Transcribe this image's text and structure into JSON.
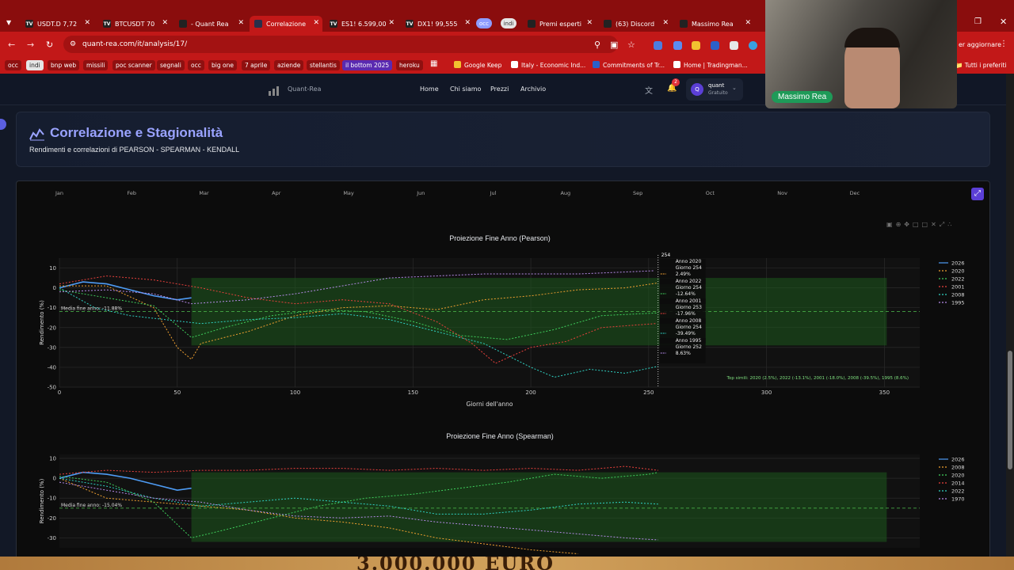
{
  "browser": {
    "tabs": [
      {
        "label": "USDT.D 7,72",
        "icon": "tv-icon"
      },
      {
        "label": "BTCUSDT 70",
        "icon": "tv-icon"
      },
      {
        "label": "- Quant Rea",
        "icon": "quant-icon"
      },
      {
        "label": "Correlazione",
        "icon": "quant-icon"
      },
      {
        "label": "ES1! 6.599,00",
        "icon": "tv-icon"
      },
      {
        "label": "DX1! 99,555",
        "icon": "tv-icon"
      },
      {
        "label": "Premi esperti",
        "icon": "page-icon"
      },
      {
        "label": "(63) Discord",
        "icon": "discord-icon"
      },
      {
        "label": "Massimo Rea",
        "icon": "page-icon"
      }
    ],
    "tab_pills": [
      "occ",
      "indi"
    ],
    "url": "quant-rea.com/it/analysis/17/",
    "update_label": "er aggiornare",
    "bookmarks": [
      "occ",
      "indi",
      "bnp web",
      "missili",
      "poc scanner",
      "segnali",
      "occ",
      "big one",
      "7 aprile",
      "aziende",
      "stellantis",
      "il bottom 2025",
      "heroku"
    ],
    "bookmark_links": [
      "Google Keep",
      "Italy - Economic Ind...",
      "Commitments of Tr...",
      "Home | Tradingman..."
    ],
    "all_bookmarks": "Tutti i preferiti"
  },
  "site": {
    "brand": "Quant-Rea",
    "nav": [
      "Home",
      "Chi siamo",
      "Prezzi",
      "Archivio"
    ],
    "notif_count": "2",
    "user_initial": "Q",
    "user_name": "quant",
    "user_plan": "Gratuito"
  },
  "hero": {
    "title": "Correlazione e Stagionalità",
    "subtitle": "Rendimenti e correlazioni di PEARSON - SPEARMAN - KENDALL"
  },
  "top_axis_months": [
    "Jan",
    "Feb",
    "Mar",
    "Apr",
    "May",
    "Jun",
    "Jul",
    "Aug",
    "Sep",
    "Oct",
    "Nov",
    "Dec"
  ],
  "webcam": {
    "label": "Massimo Rea"
  },
  "poster_text": "3.000.000 EURO",
  "chart_data": [
    {
      "type": "line",
      "title": "Proiezione Fine Anno (Pearson)",
      "xlabel": "Giorni dell'anno",
      "ylabel": "Rendimento (%)",
      "xlim": [
        0,
        365
      ],
      "ylim": [
        -50,
        15
      ],
      "xticks": [
        0,
        50,
        100,
        150,
        200,
        250,
        300,
        350
      ],
      "yticks": [
        10,
        0,
        -10,
        -20,
        -30,
        -40,
        -50
      ],
      "mean_label": "Media fine anno: -11.88%",
      "mean_value": -11.88,
      "band": [
        -29,
        5
      ],
      "band_start": 56,
      "cursor_day": 254,
      "hover_header": "254",
      "hover": [
        {
          "year": "Anno 2020",
          "day": "Giorno 254",
          "value": "2.49%"
        },
        {
          "year": "Anno 2022",
          "day": "Giorno 254",
          "value": "-12.64%"
        },
        {
          "year": "Anno 2001",
          "day": "Giorno 253",
          "value": "-17.96%"
        },
        {
          "year": "Anno 2008",
          "day": "Giorno 254",
          "value": "-39.49%"
        },
        {
          "year": "Anno 1995",
          "day": "Giorno 252",
          "value": "8.63%"
        }
      ],
      "top_similar": "Top simili: 2020 (2.5%), 2022 (-13.1%), 2001 (-18.0%), 2008 (-39.5%), 1995 (8.6%)",
      "series": [
        {
          "name": "2026",
          "color": "#4e9cf5",
          "dash": "",
          "points": [
            [
              0,
              0
            ],
            [
              10,
              3
            ],
            [
              20,
              2
            ],
            [
              30,
              -1
            ],
            [
              40,
              -4
            ],
            [
              50,
              -6
            ],
            [
              56,
              -5
            ]
          ]
        },
        {
          "name": "2020",
          "color": "#f0a030",
          "dash": "2,2",
          "points": [
            [
              0,
              1
            ],
            [
              20,
              1
            ],
            [
              40,
              -10
            ],
            [
              50,
              -30
            ],
            [
              56,
              -36
            ],
            [
              60,
              -28
            ],
            [
              80,
              -22
            ],
            [
              100,
              -14
            ],
            [
              120,
              -10
            ],
            [
              140,
              -9
            ],
            [
              160,
              -11
            ],
            [
              180,
              -6
            ],
            [
              200,
              -4
            ],
            [
              220,
              -1
            ],
            [
              240,
              0
            ],
            [
              254,
              2.5
            ]
          ]
        },
        {
          "name": "2022",
          "color": "#3fcf5c",
          "dash": "2,2",
          "points": [
            [
              0,
              -1
            ],
            [
              20,
              -5
            ],
            [
              40,
              -9
            ],
            [
              56,
              -25
            ],
            [
              70,
              -20
            ],
            [
              90,
              -14
            ],
            [
              110,
              -11
            ],
            [
              130,
              -12
            ],
            [
              150,
              -17
            ],
            [
              170,
              -24
            ],
            [
              190,
              -26
            ],
            [
              210,
              -21
            ],
            [
              230,
              -14
            ],
            [
              254,
              -12.6
            ]
          ]
        },
        {
          "name": "2001",
          "color": "#e8413c",
          "dash": "2,2",
          "points": [
            [
              0,
              2
            ],
            [
              20,
              6
            ],
            [
              40,
              4
            ],
            [
              60,
              0
            ],
            [
              80,
              -5
            ],
            [
              100,
              -8
            ],
            [
              120,
              -6
            ],
            [
              140,
              -8
            ],
            [
              160,
              -17
            ],
            [
              175,
              -28
            ],
            [
              185,
              -38
            ],
            [
              200,
              -30
            ],
            [
              215,
              -27
            ],
            [
              230,
              -20
            ],
            [
              253,
              -18
            ]
          ]
        },
        {
          "name": "2008",
          "color": "#2fd1c2",
          "dash": "2,2",
          "points": [
            [
              0,
              0
            ],
            [
              15,
              -10
            ],
            [
              30,
              -14
            ],
            [
              45,
              -16
            ],
            [
              60,
              -18
            ],
            [
              80,
              -16
            ],
            [
              100,
              -15
            ],
            [
              120,
              -13
            ],
            [
              140,
              -16
            ],
            [
              160,
              -22
            ],
            [
              180,
              -28
            ],
            [
              200,
              -40
            ],
            [
              210,
              -45
            ],
            [
              225,
              -41
            ],
            [
              240,
              -43
            ],
            [
              254,
              -39.5
            ]
          ]
        },
        {
          "name": "1995",
          "color": "#b58ae8",
          "dash": "2,2",
          "points": [
            [
              0,
              -2
            ],
            [
              20,
              -1
            ],
            [
              40,
              -3
            ],
            [
              56,
              -8
            ],
            [
              80,
              -6
            ],
            [
              100,
              -3
            ],
            [
              120,
              1
            ],
            [
              140,
              5
            ],
            [
              160,
              6
            ],
            [
              180,
              7
            ],
            [
              200,
              7
            ],
            [
              220,
              7
            ],
            [
              240,
              8
            ],
            [
              252,
              8.6
            ]
          ]
        }
      ]
    },
    {
      "type": "line",
      "title": "Proiezione Fine Anno (Spearman)",
      "xlabel": "",
      "ylabel": "Rendimento (%)",
      "xlim": [
        0,
        365
      ],
      "ylim": [
        -35,
        12
      ],
      "yticks": [
        10,
        0,
        -10,
        -20,
        -30
      ],
      "mean_label": "Media fine anno: -15.04%",
      "mean_value": -15.04,
      "band": [
        -32,
        3
      ],
      "band_start": 56,
      "series": [
        {
          "name": "2026",
          "color": "#4e9cf5",
          "dash": "",
          "points": [
            [
              0,
              0
            ],
            [
              10,
              3
            ],
            [
              20,
              2
            ],
            [
              30,
              0
            ],
            [
              40,
              -3
            ],
            [
              50,
              -6
            ],
            [
              56,
              -5
            ]
          ]
        },
        {
          "name": "2008",
          "color": "#f0a030",
          "dash": "2,2",
          "points": [
            [
              0,
              0
            ],
            [
              20,
              -10
            ],
            [
              40,
              -12
            ],
            [
              60,
              -14
            ],
            [
              80,
              -16
            ],
            [
              100,
              -20
            ],
            [
              120,
              -22
            ],
            [
              140,
              -25
            ],
            [
              160,
              -30
            ],
            [
              180,
              -33
            ],
            [
              200,
              -36
            ],
            [
              220,
              -38
            ]
          ]
        },
        {
          "name": "2020",
          "color": "#3fcf5c",
          "dash": "2,2",
          "points": [
            [
              0,
              1
            ],
            [
              20,
              -2
            ],
            [
              40,
              -12
            ],
            [
              56,
              -30
            ],
            [
              70,
              -26
            ],
            [
              90,
              -20
            ],
            [
              110,
              -14
            ],
            [
              130,
              -10
            ],
            [
              150,
              -8
            ],
            [
              170,
              -5
            ],
            [
              190,
              -2
            ],
            [
              210,
              2
            ],
            [
              230,
              0
            ],
            [
              250,
              2
            ],
            [
              254,
              3
            ]
          ]
        },
        {
          "name": "2014",
          "color": "#e8413c",
          "dash": "2,2",
          "points": [
            [
              0,
              2
            ],
            [
              20,
              4
            ],
            [
              40,
              3
            ],
            [
              60,
              4
            ],
            [
              80,
              4
            ],
            [
              100,
              5
            ],
            [
              120,
              5
            ],
            [
              140,
              4
            ],
            [
              160,
              5
            ],
            [
              180,
              4
            ],
            [
              200,
              5
            ],
            [
              220,
              4
            ],
            [
              240,
              6
            ],
            [
              254,
              4
            ]
          ]
        },
        {
          "name": "2022",
          "color": "#2fd1c2",
          "dash": "2,2",
          "points": [
            [
              0,
              0
            ],
            [
              20,
              -4
            ],
            [
              40,
              -10
            ],
            [
              60,
              -14
            ],
            [
              80,
              -12
            ],
            [
              100,
              -10
            ],
            [
              120,
              -12
            ],
            [
              140,
              -14
            ],
            [
              160,
              -18
            ],
            [
              180,
              -18
            ],
            [
              200,
              -16
            ],
            [
              220,
              -13
            ],
            [
              240,
              -12
            ],
            [
              254,
              -13
            ]
          ]
        },
        {
          "name": "1970",
          "color": "#b58ae8",
          "dash": "2,2",
          "points": [
            [
              0,
              -2
            ],
            [
              20,
              -6
            ],
            [
              40,
              -10
            ],
            [
              60,
              -12
            ],
            [
              80,
              -16
            ],
            [
              100,
              -19
            ],
            [
              120,
              -20
            ],
            [
              140,
              -19
            ],
            [
              160,
              -22
            ],
            [
              180,
              -24
            ],
            [
              200,
              -26
            ],
            [
              220,
              -28
            ],
            [
              240,
              -30
            ],
            [
              254,
              -31
            ]
          ]
        }
      ]
    }
  ]
}
